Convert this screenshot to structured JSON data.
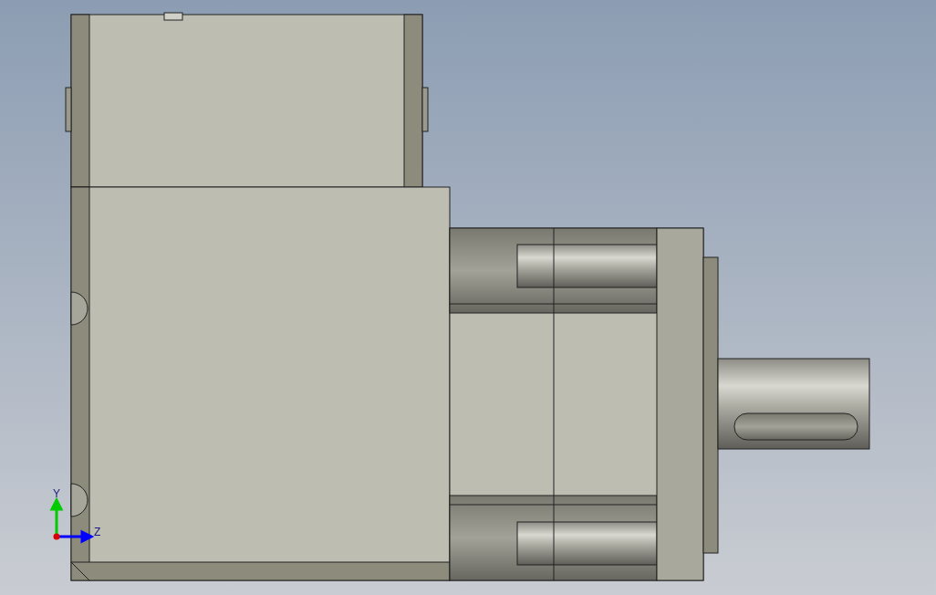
{
  "viewport": {
    "axis_triad": {
      "axes": [
        {
          "kind": "y",
          "label": "Y",
          "color": "#00cc00"
        },
        {
          "kind": "z",
          "label": "Z",
          "color": "#0000ff"
        }
      ]
    }
  }
}
